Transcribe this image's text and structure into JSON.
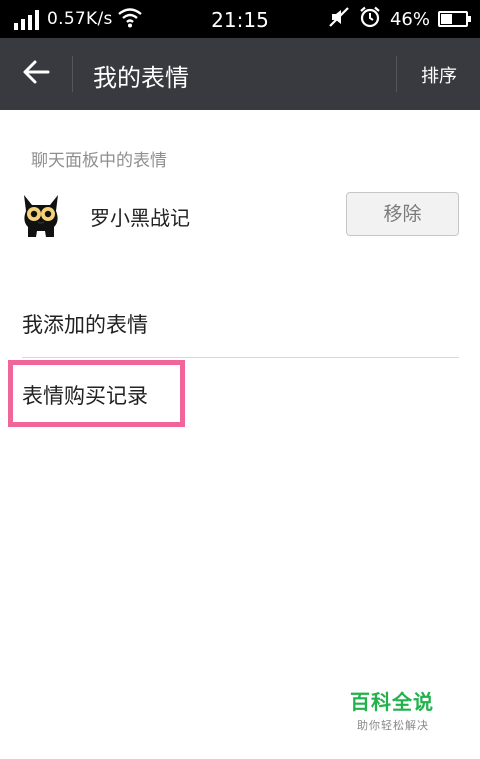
{
  "status_bar": {
    "net_speed": "0.57K/s",
    "time": "21:15",
    "battery_percent_label": "46%",
    "battery_level": 0.46
  },
  "title_bar": {
    "title": "我的表情",
    "sort_label": "排序",
    "back_icon": "arrow-left-icon"
  },
  "content": {
    "section_label": "聊天面板中的表情",
    "sticker": {
      "name": "罗小黑战记",
      "remove_label": "移除"
    },
    "menu_items": [
      {
        "label": "我添加的表情"
      },
      {
        "label": "表情购买记录"
      }
    ],
    "highlight_color": "#f0669a"
  },
  "watermark": {
    "main": "百科全说",
    "sub": "助你轻松解决"
  }
}
